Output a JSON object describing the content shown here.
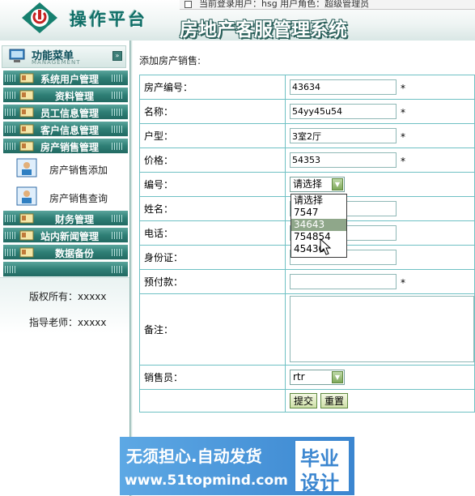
{
  "header": {
    "brand": "操作平台",
    "system_title": "房地产客服管理系统",
    "top_status": "当前登录用户：hsg  用户角色：超级管理员"
  },
  "sidebar": {
    "menu_title": "功能菜单",
    "menu_subtitle": "MANAGEMENT",
    "items": [
      {
        "label": "系统用户管理"
      },
      {
        "label": "资料管理"
      },
      {
        "label": "员工信息管理"
      },
      {
        "label": "客户信息管理"
      },
      {
        "label": "房产销售管理"
      }
    ],
    "sub_items": [
      {
        "label": "房产销售添加"
      },
      {
        "label": "房产销售查询"
      }
    ],
    "items_after": [
      {
        "label": "财务管理"
      },
      {
        "label": "站内新闻管理"
      },
      {
        "label": "数据备份"
      }
    ],
    "footer": {
      "copyright": "版权所有：xxxxx",
      "advisor": "指导老师：xxxxx"
    }
  },
  "main": {
    "heading": "添加房产销售:",
    "fields": {
      "property_no": {
        "label": "房产编号：",
        "value": "43634",
        "required": "*"
      },
      "name": {
        "label": "名称：",
        "value": "54yy45u54",
        "required": "*"
      },
      "layout": {
        "label": "户型：",
        "value": "3室2厅",
        "required": "*"
      },
      "price": {
        "label": "价格：",
        "value": "54353",
        "required": "*"
      },
      "code": {
        "label": "编号：",
        "selected": "请选择"
      },
      "customer_name": {
        "label": "姓名：",
        "value": ""
      },
      "phone": {
        "label": "电话：",
        "value": ""
      },
      "id_card": {
        "label": "身份证：",
        "value": ""
      },
      "deposit": {
        "label": "预付款：",
        "value": "",
        "required": "*"
      },
      "notes": {
        "label": "备注：",
        "value": ""
      },
      "salesperson": {
        "label": "销售员：",
        "selected": "rtr"
      }
    },
    "code_dropdown": {
      "options": [
        "请选择",
        "7547",
        "34643",
        "754854",
        "45436"
      ],
      "highlighted": "34643"
    },
    "buttons": {
      "submit": "提交",
      "reset": "重置"
    }
  },
  "banner": {
    "slogan": "无须担心.自动发货",
    "url": "www.51topmind.com",
    "box_line1": "毕业",
    "box_line2": "设计"
  },
  "colors": {
    "teal_primary": "#2f7f76",
    "table_border": "#6fc1c4",
    "highlight": "#8fa78a",
    "banner_blue": "#3b86d0"
  }
}
